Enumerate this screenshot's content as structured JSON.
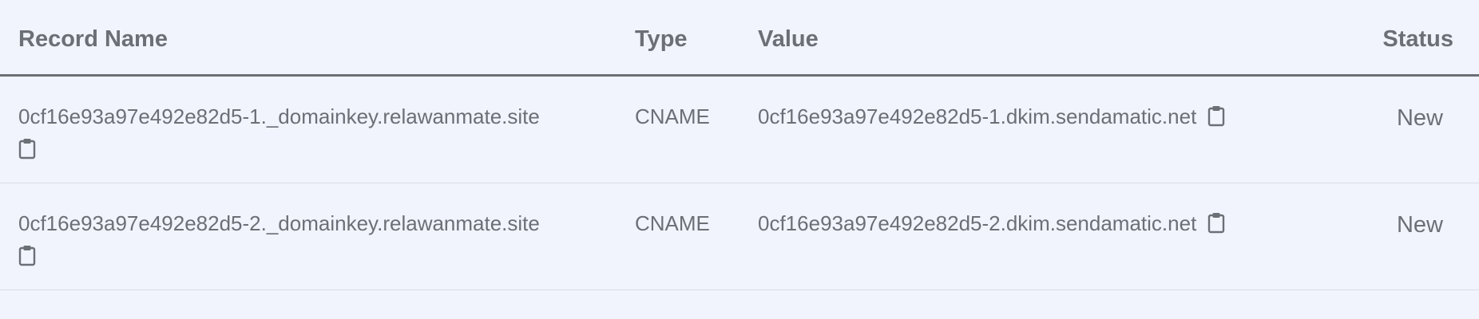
{
  "table": {
    "columns": {
      "name": "Record Name",
      "type": "Type",
      "value": "Value",
      "status": "Status"
    },
    "rows": [
      {
        "name": "0cf16e93a97e492e82d5-1._domainkey.relawanmate.site",
        "type": "CNAME",
        "value": "0cf16e93a97e492e82d5-1.dkim.sendamatic.net",
        "status": "New"
      },
      {
        "name": "0cf16e93a97e492e82d5-2._domainkey.relawanmate.site",
        "type": "CNAME",
        "value": "0cf16e93a97e492e82d5-2.dkim.sendamatic.net",
        "status": "New"
      }
    ]
  },
  "icons": {
    "copy": "clipboard-icon"
  },
  "colors": {
    "background": "#f1f4fd",
    "text": "#6b6f76",
    "divider": "#d9dde6"
  }
}
